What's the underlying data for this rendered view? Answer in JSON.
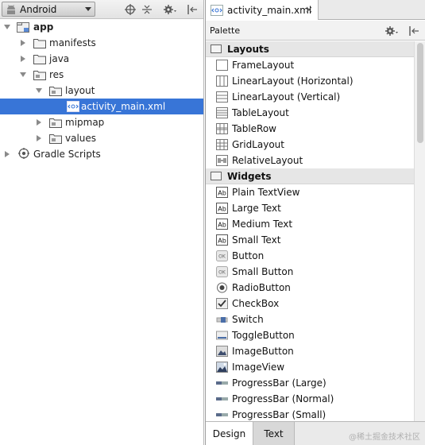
{
  "project_panel": {
    "view_selector": "Android",
    "icons": [
      "android-icon",
      "target-icon",
      "collapse-all-icon",
      "gear-icon",
      "hide-panel-icon"
    ]
  },
  "tree": {
    "app": "app",
    "manifests": "manifests",
    "java": "java",
    "res": "res",
    "layout": "layout",
    "activity_main": "activity_main.xml",
    "mipmap": "mipmap",
    "values": "values",
    "gradle": "Gradle Scripts"
  },
  "editor": {
    "file_tab": "activity_main.xml",
    "close_glyph": "×"
  },
  "palette": {
    "title": "Palette",
    "layouts_header": "Layouts",
    "layouts": [
      {
        "label": "FrameLayout",
        "icon": "frame-layout-icon"
      },
      {
        "label": "LinearLayout (Horizontal)",
        "icon": "linear-horizontal-icon"
      },
      {
        "label": "LinearLayout (Vertical)",
        "icon": "linear-vertical-icon"
      },
      {
        "label": "TableLayout",
        "icon": "table-layout-icon"
      },
      {
        "label": "TableRow",
        "icon": "table-row-icon"
      },
      {
        "label": "GridLayout",
        "icon": "grid-layout-icon"
      },
      {
        "label": "RelativeLayout",
        "icon": "relative-layout-icon"
      }
    ],
    "widgets_header": "Widgets",
    "widgets": [
      {
        "label": "Plain TextView",
        "icon": "text-ab-icon"
      },
      {
        "label": "Large Text",
        "icon": "text-ab-icon"
      },
      {
        "label": "Medium Text",
        "icon": "text-ab-icon"
      },
      {
        "label": "Small Text",
        "icon": "text-ab-icon"
      },
      {
        "label": "Button",
        "icon": "button-ok-icon"
      },
      {
        "label": "Small Button",
        "icon": "button-ok-icon"
      },
      {
        "label": "RadioButton",
        "icon": "radio-icon"
      },
      {
        "label": "CheckBox",
        "icon": "checkbox-icon"
      },
      {
        "label": "Switch",
        "icon": "switch-icon"
      },
      {
        "label": "ToggleButton",
        "icon": "toggle-icon"
      },
      {
        "label": "ImageButton",
        "icon": "image-button-icon"
      },
      {
        "label": "ImageView",
        "icon": "image-view-icon"
      },
      {
        "label": "ProgressBar (Large)",
        "icon": "progress-icon"
      },
      {
        "label": "ProgressBar (Normal)",
        "icon": "progress-icon"
      },
      {
        "label": "ProgressBar (Small)",
        "icon": "progress-icon"
      }
    ],
    "icon_text_ab": "Ab",
    "icon_text_ok": "OK"
  },
  "bottom_tabs": {
    "design": "Design",
    "text": "Text"
  },
  "watermark": "@稀土掘金技术社区",
  "colors": {
    "selection": "#3875d7",
    "section_bg": "#e6e6e6",
    "folder_blue": "#6b8fbf"
  }
}
